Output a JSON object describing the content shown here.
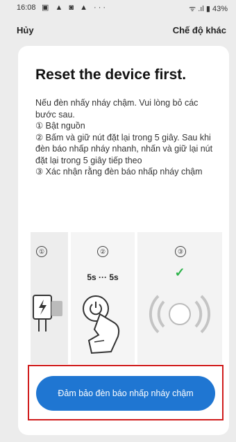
{
  "status_bar": {
    "time": "16:08",
    "icons_left": "▣ ▲ ◙ ▲ ···",
    "icons_right": "ᯤ .ıl ▮ 43%"
  },
  "header": {
    "cancel_label": "Hủy",
    "other_mode_label": "Chế độ khác"
  },
  "card": {
    "title": "Reset the device first.",
    "instructions": [
      "Nếu đèn nhấy nháy chậm. Vui lòng bỏ các bước sau.",
      "① Bật nguồn",
      "② Bấm và giữ nút đặt lại trong 5 giây. Sau khi đèn báo nhấp nháy nhanh, nhấn và giữ lại nút đặt lại trong 5 giây tiếp theo",
      "③ Xác nhận rằng đèn báo nhấp nháy chậm"
    ],
    "steps": [
      {
        "number": "①"
      },
      {
        "number": "②",
        "timing": "5s ··· 5s"
      },
      {
        "number": "③",
        "indicator": "✓"
      }
    ],
    "confirm_button": "Đảm bảo đèn báo nhấp nháy chậm"
  },
  "colors": {
    "accent": "#1f76d2",
    "highlight_border": "#d01c1c",
    "check": "#2db34a"
  }
}
